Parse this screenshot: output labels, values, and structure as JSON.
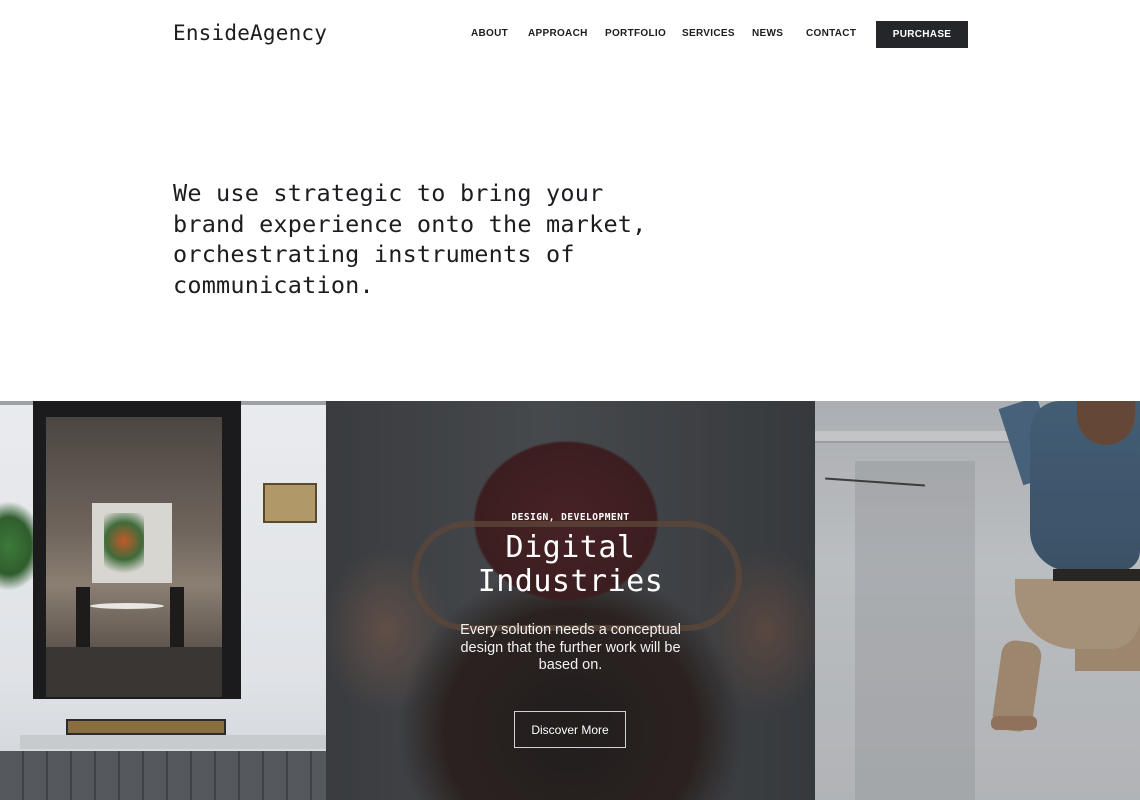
{
  "header": {
    "logo": "EnsideAgency",
    "nav": [
      "ABOUT",
      "APPROACH",
      "PORTFOLIO",
      "SERVICES",
      "NEWS",
      "CONTACT"
    ],
    "purchase_label": "PURCHASE"
  },
  "intro": {
    "lines": [
      "We use strategic to bring your",
      "brand experience onto the market,",
      "orchestrating instruments of",
      "communication."
    ]
  },
  "featured": {
    "category": "DESIGN, DEVELOPMENT",
    "title_lines": [
      "Digital",
      "Industries"
    ],
    "description": "Every solution needs a conceptual design that the further work will be based on.",
    "button_label": "Discover More"
  },
  "colors": {
    "text": "#1c1d21",
    "button_bg": "#25262a",
    "white": "#ffffff"
  }
}
